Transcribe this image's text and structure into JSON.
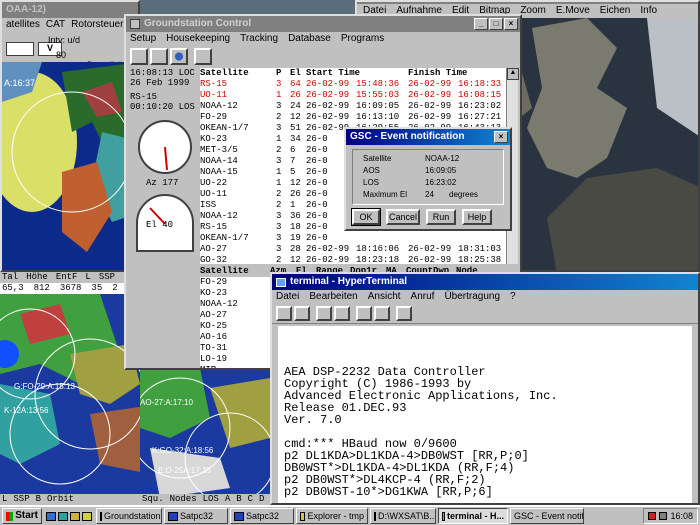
{
  "noaa_window": {
    "title": "OAA-12)",
    "field_v1": "",
    "field_v2": "V",
    "intv_label": "Intv: u/d",
    "intv_value": "80",
    "downlink": "Downlink",
    "menu": [
      "atellites",
      "CAT",
      "Rotorsteuerung"
    ],
    "map_labels": [
      "A:16:37"
    ]
  },
  "pic_window": {
    "menu": [
      "Datei",
      "Aufnahme",
      "Edit",
      "Bitmap",
      "Zoom",
      "E.Move",
      "Eichen",
      "Info"
    ]
  },
  "left_strip": {
    "header": [
      "Tal",
      "Höhe",
      "EntF",
      "L",
      "SSP"
    ],
    "values": [
      "65,3",
      "812",
      "3678",
      "35",
      "2"
    ],
    "bottom_header": [
      "L",
      "SSP",
      "B",
      "Orbit",
      "Squ.",
      "Nodes",
      "LOS"
    ],
    "bottom_letters": [
      "A",
      "B",
      "C",
      "D",
      "E"
    ],
    "map_labels": [
      "G:FO-29:A:15:13",
      "K-12A:13:56",
      "H:AO-27:A:17:10",
      "K:GO-32:A:18:56",
      "E:O-25A:17:35"
    ]
  },
  "gsc": {
    "title": "Groundstation Control",
    "menu": [
      "Setup",
      "Housekeeping",
      "Tracking",
      "Database",
      "Programs"
    ],
    "time1": "16:08:13 LOC",
    "date1": "26 Feb 1999",
    "sat1": "RS-15",
    "time2": "00:10:20 LOS",
    "az_label": "Az 177",
    "el_label": "El 40",
    "table_header": [
      "Satellite",
      "P",
      "El",
      "Start Time",
      "Finish Time"
    ],
    "rows": [
      [
        "RS-15",
        "3",
        "64",
        "26-02-99",
        "15:48:36",
        "26-02-99",
        "16:18:33",
        true
      ],
      [
        "UO-11",
        "1",
        "26",
        "26-02-99",
        "15:55:03",
        "26-02-99",
        "16:08:15",
        true
      ],
      [
        "NOAA-12",
        "3",
        "24",
        "26-02-99",
        "16:09:05",
        "26-02-99",
        "16:23:02",
        false
      ],
      [
        "FO-29",
        "2",
        "12",
        "26-02-99",
        "16:13:10",
        "26-02-99",
        "16:27:21",
        false
      ],
      [
        "OKEAN-1/7",
        "3",
        "51",
        "26-02-99",
        "16:29:55",
        "26-02-99",
        "16:43:13",
        false
      ],
      [
        "KO-23",
        "1",
        "34",
        "26-0",
        "",
        "",
        "",
        false
      ],
      [
        "MET-3/5",
        "2",
        "6",
        "26-0",
        "",
        "",
        "",
        false
      ],
      [
        "NOAA-14",
        "3",
        "7",
        "26-0",
        "",
        "",
        "",
        false
      ],
      [
        "NOAA-15",
        "1",
        "5",
        "26-0",
        "",
        "",
        "",
        false
      ],
      [
        "UO-22",
        "1",
        "12",
        "26-0",
        "",
        "",
        "",
        false
      ],
      [
        "UO-11",
        "2",
        "26",
        "26-0",
        "",
        "",
        "",
        false
      ],
      [
        "ISS",
        "2",
        "1",
        "26-0",
        "",
        "",
        "",
        false
      ],
      [
        "NOAA-12",
        "3",
        "36",
        "26-0",
        "",
        "",
        "",
        false
      ],
      [
        "RS-15",
        "3",
        "18",
        "26-0",
        "",
        "",
        "",
        false
      ],
      [
        "OKEAN-1/7",
        "3",
        "19",
        "26-0",
        "",
        "",
        "",
        false
      ],
      [
        "AO-27",
        "3",
        "28",
        "26-02-99",
        "18:16:06",
        "26-02-99",
        "18:31:03",
        false
      ],
      [
        "GO-32",
        "2",
        "12",
        "26-02-99",
        "18:23:18",
        "26-02-99",
        "18:25:38",
        false
      ],
      [
        "KO-25",
        "1",
        "21",
        "26-02-99",
        "18:23:59",
        "26-02-99",
        "18:38:03",
        false
      ]
    ],
    "lower_header": [
      "Satellite",
      "Azm",
      "El",
      "Range",
      "Dop1r",
      "MA",
      "CountDwn",
      "Node"
    ],
    "lower_sats": [
      "FO-29",
      "KO-23",
      "NOAA-12",
      "AO-27",
      "KO-25",
      "AO-16",
      "TO-31",
      "LO-19",
      "MIR"
    ]
  },
  "event": {
    "title": "GSC - Event notification",
    "satellite_label": "Satellite",
    "satellite": "NOAA-12",
    "aos_label": "AOS",
    "aos": "16:09:05",
    "los_label": "LOS",
    "los": "16:23:02",
    "maxel_label": "Maximum El",
    "maxel": "24",
    "maxel_unit": "degrees",
    "ok": "OK",
    "cancel": "Cancel",
    "run": "Run",
    "help": "Help"
  },
  "terminal": {
    "title": "terminal - HyperTerminal",
    "menu": [
      "Datei",
      "Bearbeiten",
      "Ansicht",
      "Anruf",
      "Übertragung",
      "?"
    ],
    "lines": [
      "AEA DSP-2232 Data Controller",
      "Copyright (C) 1986-1993 by",
      "Advanced Electronic Applications, Inc.",
      "Release 01.DEC.93",
      "Ver. 7.0",
      "",
      "cmd:*** HBaud now 0/9600",
      "p2 DL1KDA>DL1KDA-4>DB0WST [RR,P;0]",
      "DB0WST*>DL1KDA-4>DL1KDA (RR,F;4)",
      "p2 DB0WST*>DL4KCP-4 (RR,F;2)",
      "p2 DB0WST-10*>DG1KWA [RR,P;6]"
    ]
  },
  "taskbar": {
    "start": "Start",
    "clock": "16:08",
    "items": [
      "Groundstation...",
      "Satpc32",
      "Satpc32",
      "Explorer - tmp",
      "D:\\WXSAT\\B...",
      "terminal - H...",
      "GSC - Event notifi..."
    ]
  }
}
